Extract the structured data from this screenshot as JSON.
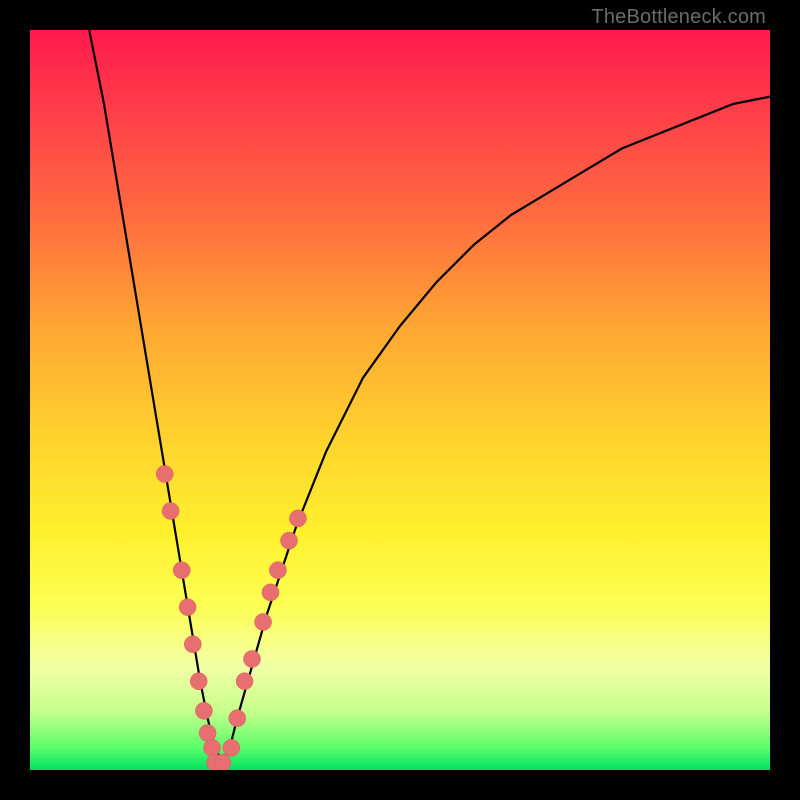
{
  "watermark": "TheBottleneck.com",
  "chart_data": {
    "type": "line",
    "title": "",
    "xlabel": "",
    "ylabel": "",
    "xlim": [
      0,
      100
    ],
    "ylim": [
      0,
      100
    ],
    "series": [
      {
        "name": "bottleneck-curve",
        "x": [
          8,
          10,
          12,
          14,
          16,
          18,
          20,
          22,
          23,
          24,
          25,
          26,
          27,
          28,
          30,
          32,
          34,
          36,
          40,
          45,
          50,
          55,
          60,
          65,
          70,
          75,
          80,
          85,
          90,
          95,
          100
        ],
        "y": [
          100,
          90,
          78,
          66,
          54,
          42,
          30,
          18,
          12,
          7,
          3,
          1,
          3,
          7,
          14,
          21,
          27,
          33,
          43,
          53,
          60,
          66,
          71,
          75,
          78,
          81,
          84,
          86,
          88,
          90,
          91
        ]
      }
    ],
    "markers": {
      "name": "highlight-dots",
      "left_branch": {
        "x": [
          18.2,
          19.0,
          20.5,
          21.3,
          22.0,
          22.8,
          23.5,
          24.0,
          24.6
        ],
        "y": [
          40.0,
          35.0,
          27.0,
          22.0,
          17.0,
          12.0,
          8.0,
          5.0,
          3.0
        ]
      },
      "right_branch": {
        "x": [
          27.2,
          28.0,
          29.0,
          30.0,
          31.5,
          32.5,
          33.5,
          35.0,
          36.2
        ],
        "y": [
          3.0,
          7.0,
          12.0,
          15.0,
          20.0,
          24.0,
          27.0,
          31.0,
          34.0
        ]
      },
      "bottom": {
        "x": [
          25.0,
          26.0
        ],
        "y": [
          1.0,
          1.0
        ]
      }
    },
    "gradient_stops": [
      {
        "pos": 0,
        "color": "#ff1a4d"
      },
      {
        "pos": 10,
        "color": "#ff3b4a"
      },
      {
        "pos": 25,
        "color": "#ff6b3f"
      },
      {
        "pos": 40,
        "color": "#ffa633"
      },
      {
        "pos": 55,
        "color": "#ffd22e"
      },
      {
        "pos": 68,
        "color": "#fff12e"
      },
      {
        "pos": 78,
        "color": "#fdff55"
      },
      {
        "pos": 86,
        "color": "#f3ffa6"
      },
      {
        "pos": 92,
        "color": "#c8ff8c"
      },
      {
        "pos": 97,
        "color": "#5bff6b"
      },
      {
        "pos": 100,
        "color": "#00e060"
      }
    ]
  }
}
